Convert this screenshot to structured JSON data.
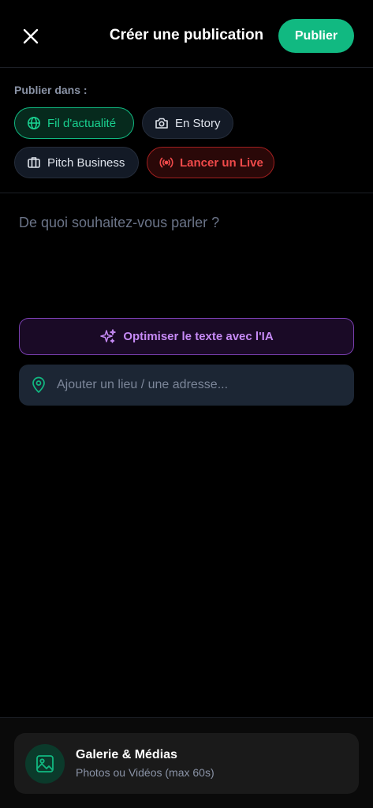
{
  "header": {
    "title": "Créer une publication",
    "publish_label": "Publier",
    "close_icon": "close-icon"
  },
  "destination": {
    "label": "Publier dans :",
    "options": [
      {
        "label": "Fil d'actualité",
        "icon": "globe-icon",
        "selected": true
      },
      {
        "label": "En Story",
        "icon": "camera-icon",
        "selected": false
      },
      {
        "label": "Pitch Business",
        "icon": "briefcase-icon",
        "selected": false
      },
      {
        "label": "Lancer un Live",
        "icon": "broadcast-icon",
        "selected": false
      }
    ]
  },
  "composer": {
    "placeholder": "De quoi souhaitez-vous parler ?"
  },
  "ai": {
    "label": "Optimiser le texte avec l'IA",
    "icon": "sparkles-icon"
  },
  "location": {
    "placeholder": "Ajouter un lieu / une adresse...",
    "icon": "map-pin-icon"
  },
  "gallery": {
    "title": "Galerie & Médias",
    "subtitle": "Photos ou Vidéos (max 60s)",
    "icon": "image-icon"
  },
  "colors": {
    "accent_green": "#11b981",
    "live_red": "#f04a4a",
    "ai_purple": "#c68af5",
    "background": "#000000"
  }
}
